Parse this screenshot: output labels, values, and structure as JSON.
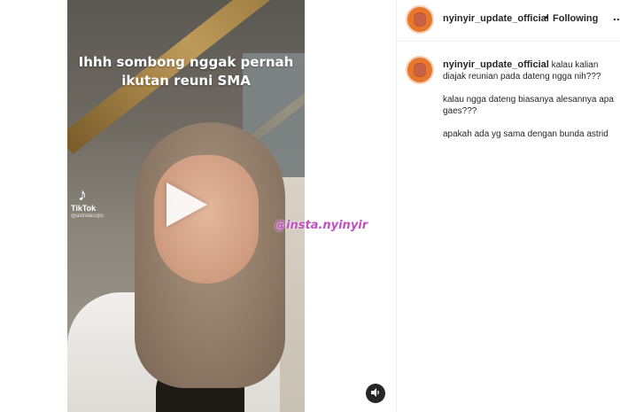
{
  "video": {
    "overlay_text": "Ihhh sombong nggak pernah ikutan reuni SMA",
    "tiktok_label": "TikTok",
    "tiktok_handle": "@astridacops",
    "watermark": "@insta.nyinyir"
  },
  "post": {
    "username": "nyinyir_update_official",
    "separator": "•",
    "follow_status": "Following",
    "more_label": "..."
  },
  "caption": {
    "username": "nyinyir_update_official",
    "first_line": "kalau kalian diajak reunian pada dateng ngga nih???",
    "paragraphs": [
      "kalau ngga dateng biasanya alesannya apa gaes???",
      "apakah ada yg sama dengan bunda astrid"
    ]
  },
  "icons": {
    "play": "play-icon",
    "sound": "speaker-icon",
    "tiktok": "tiktok-note-icon"
  },
  "colors": {
    "watermark": "#c04fc2",
    "text": "#262626",
    "divider": "#efefef"
  }
}
